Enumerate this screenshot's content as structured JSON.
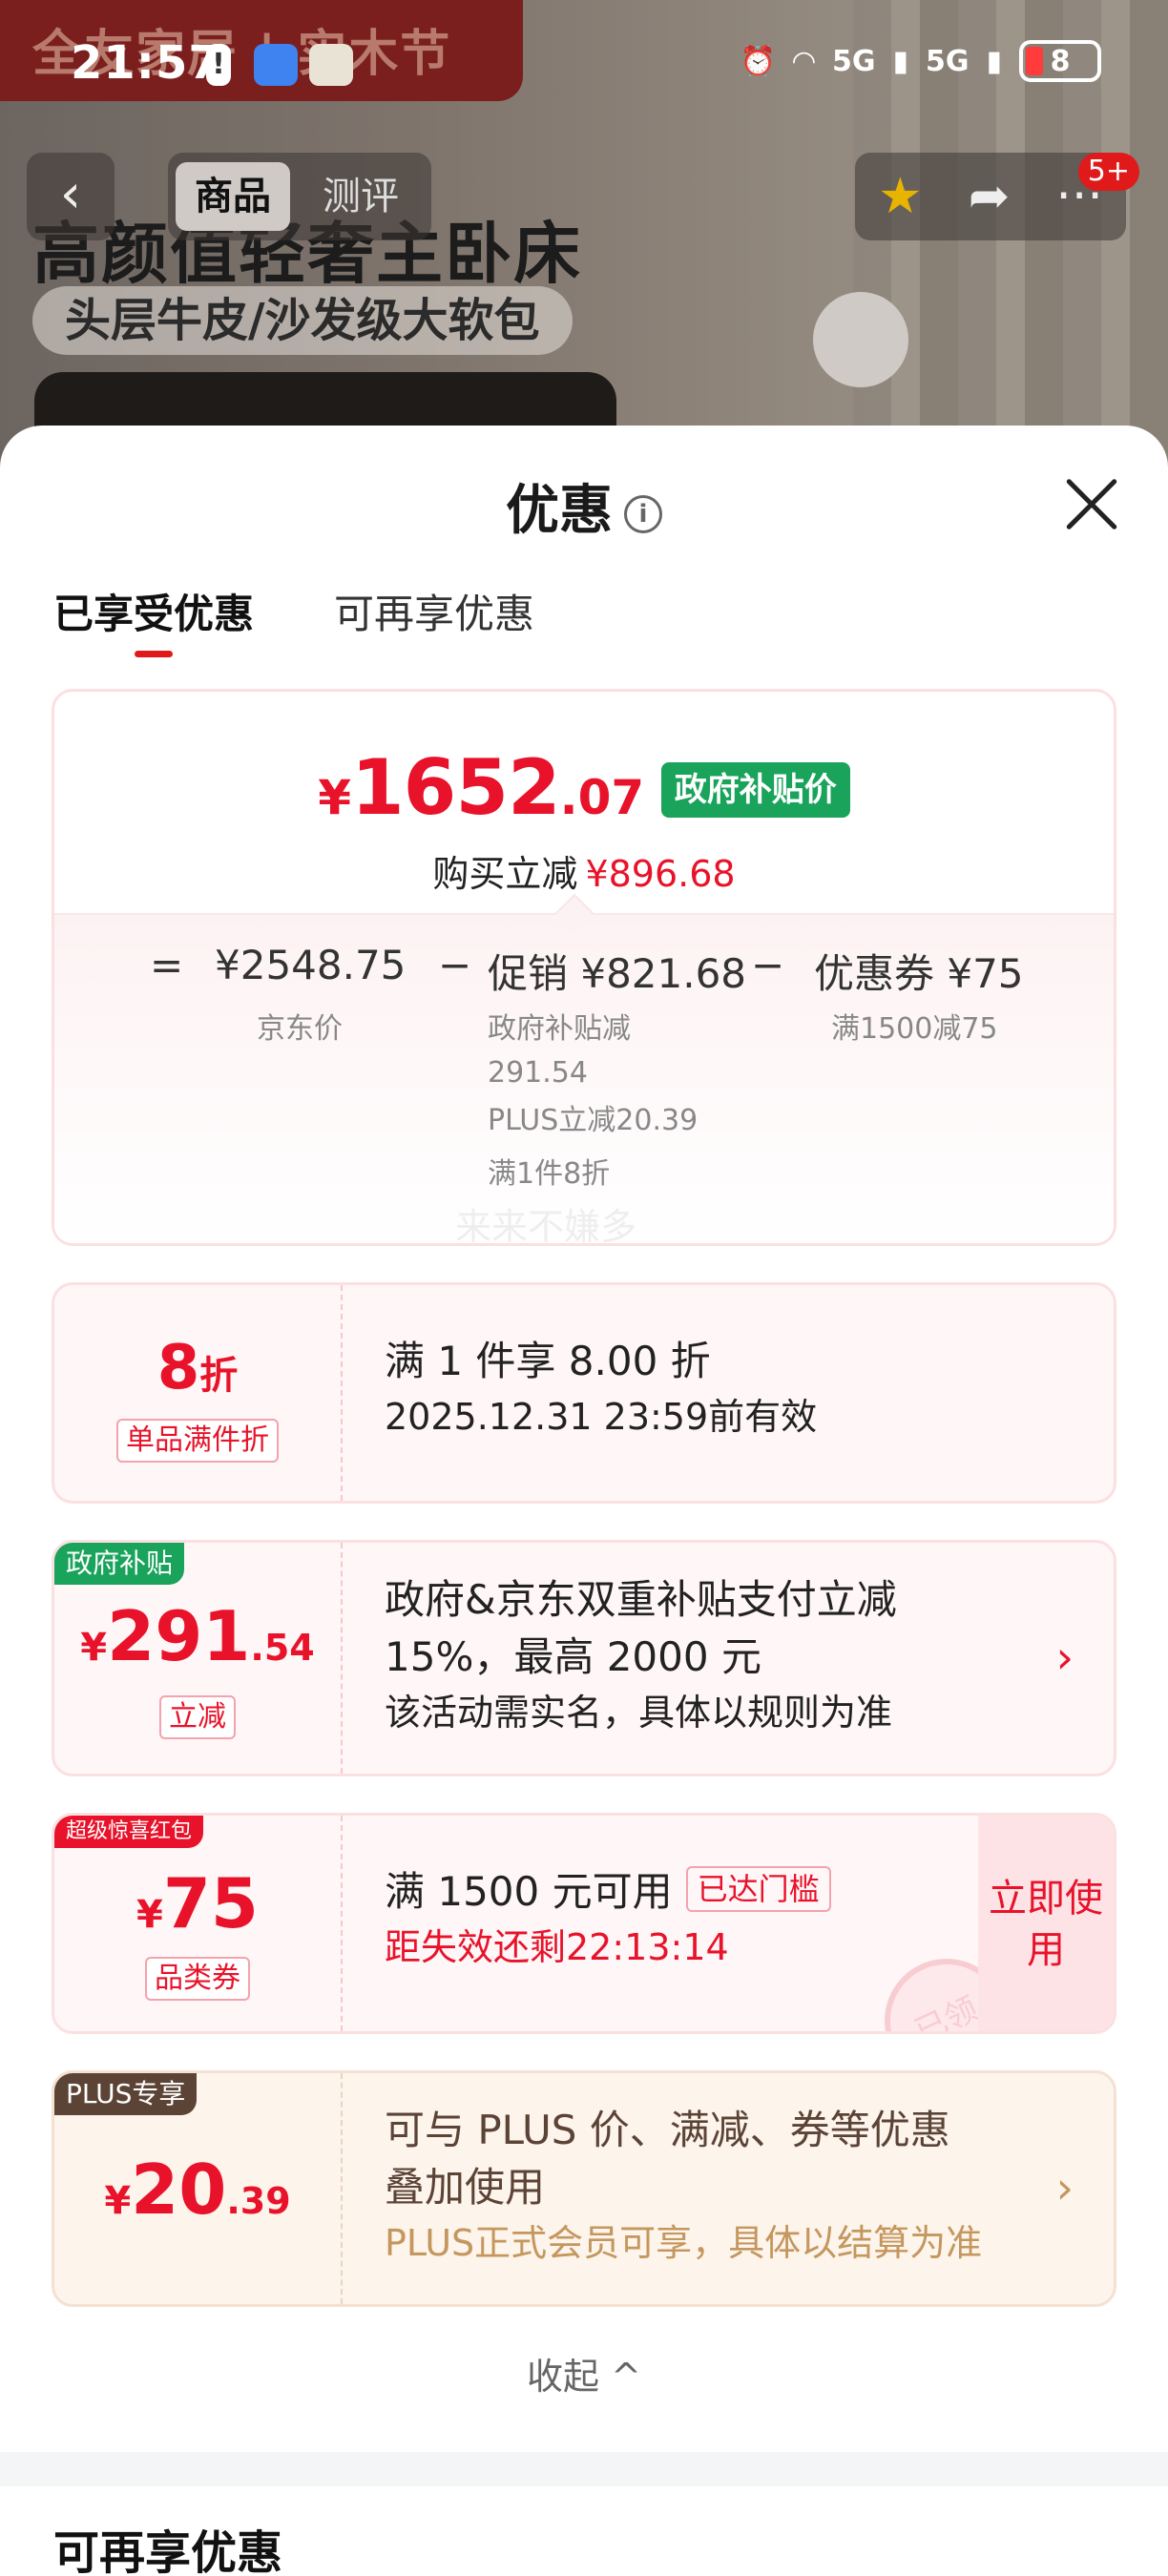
{
  "status_bar": {
    "time": "21:57",
    "network_1": "5G",
    "network_2": "5G",
    "battery": "8",
    "colors": {
      "battery_low": "#ff3b3b"
    }
  },
  "background_page": {
    "banner_text": "全友家居 | 实木节",
    "headline": "高颜值轻奢主卧床",
    "subline": "头层牛皮/沙发级大软包",
    "nav": {
      "back_icon": "chevron-left-icon",
      "tabs": [
        "商品",
        "测评"
      ],
      "active_tab": 0,
      "actions": [
        "star-icon",
        "share-icon",
        "more-icon"
      ],
      "badge": "5+"
    }
  },
  "sheet": {
    "title": "优惠",
    "info_glyph": "i",
    "tabs": [
      "已享受优惠",
      "可再享优惠"
    ],
    "active_tab": 0,
    "summary": {
      "price_currency": "¥",
      "price_int": "1652",
      "price_dec": ".07",
      "price_badge": "政府补贴价",
      "reduce_label": "购买立减",
      "reduce_value": "¥896.68",
      "eq": "=",
      "minus": "−",
      "jd_price": "¥2548.75",
      "jd_price_label": "京东价",
      "promo": "促销 ¥821.68",
      "promo_details": [
        "政府补贴减",
        "291.54",
        "PLUS立减20.39",
        "满1件8折"
      ],
      "coupon": "优惠券 ¥75",
      "coupon_detail": "满1500减75",
      "watermark": "来来不嫌多"
    },
    "cards": [
      {
        "amount_main": "8",
        "amount_suffix": "折",
        "tag": "单品满件折",
        "line1": "满 1 件享 8.00 折",
        "line2": "2025.12.31 23:59前有效"
      },
      {
        "corner": "政府补贴",
        "amount_currency": "¥",
        "amount_main": "291",
        "amount_dec": ".54",
        "tag": "立减",
        "line1": "政府&京东双重补贴支付立减",
        "line2": "15%，最高 2000 元",
        "line3": "该活动需实名，具体以规则为准",
        "chevron": "›"
      },
      {
        "corner": "超级惊喜红包",
        "amount_currency": "¥",
        "amount_main": "75",
        "tag": "品类券",
        "line1": "满 1500 元可用",
        "badge": "已达门槛",
        "countdown": "距失效还剩22:13:14",
        "button": "立即使用",
        "stamp": "已领"
      },
      {
        "corner": "PLUS专享",
        "amount_currency": "¥",
        "amount_main": "20",
        "amount_dec": ".39",
        "line1": "可与 PLUS 价、满减、券等优惠",
        "line2": "叠加使用",
        "line3": "PLUS正式会员可享，具体以结算为准",
        "chevron": "›"
      }
    ],
    "collapse_label": "收起",
    "collapse_icon": "^",
    "section_title": "可再享优惠",
    "colors": {
      "accent_red": "#e8132a",
      "gov_green": "#19a35b",
      "plus_gold": "#c4975e",
      "plus_brown": "#5b4336"
    }
  }
}
